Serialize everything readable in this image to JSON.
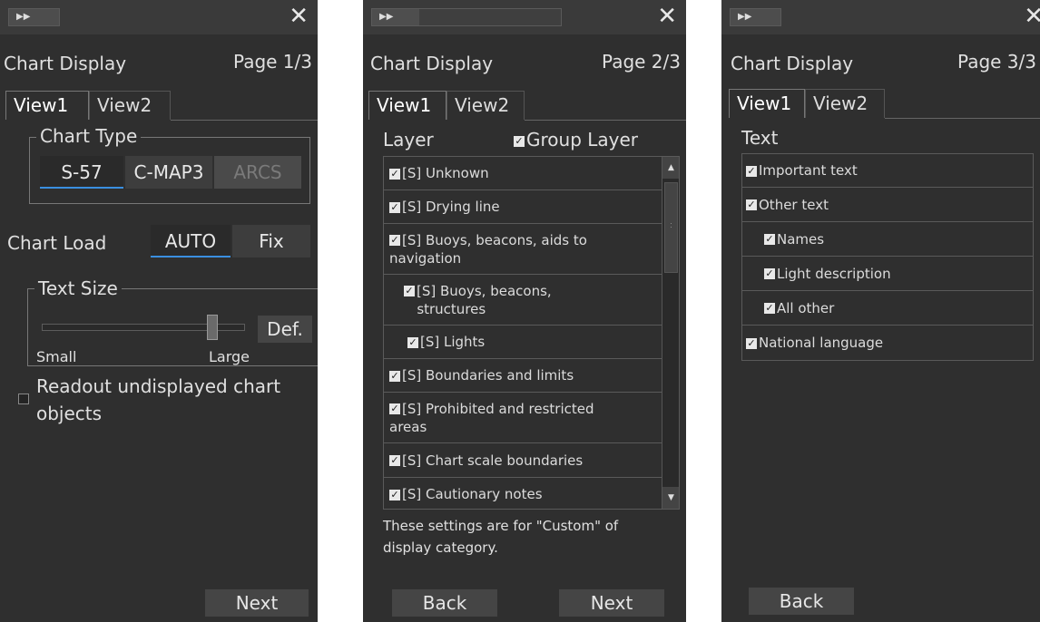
{
  "panels": [
    {
      "title": "Chart Display",
      "page": "Page 1/3",
      "tabs": [
        "View1",
        "View2"
      ],
      "chart_type": {
        "label": "Chart Type",
        "options": [
          "S-57",
          "C-MAP3",
          "ARCS"
        ],
        "selected": "S-57",
        "disabled": "ARCS"
      },
      "chart_load": {
        "label": "Chart Load",
        "options": [
          "AUTO",
          "Fix"
        ],
        "selected": "AUTO"
      },
      "text_size": {
        "label": "Text Size",
        "min_label": "Small",
        "max_label": "Large",
        "default_button": "Def.",
        "level": 0.86
      },
      "readout_checkbox": {
        "label_line1": "Readout undisplayed chart",
        "label_line2": "objects",
        "checked": false
      },
      "next_button": "Next"
    },
    {
      "title": "Chart Display",
      "page": "Page 2/3",
      "tabs": [
        "View1",
        "View2"
      ],
      "layer_label": "Layer",
      "group_layer": {
        "label": "Group Layer",
        "checked": true
      },
      "layers": [
        {
          "line1": "[S] Unknown",
          "checked": true
        },
        {
          "line1": "[S] Drying line",
          "checked": true
        },
        {
          "line1": "[S] Buoys, beacons, aids to",
          "line2": "navigation",
          "checked": true
        },
        {
          "line1": "[S] Buoys, beacons,",
          "line2": "structures",
          "checked": true
        },
        {
          "line1": "[S] Lights",
          "checked": true
        },
        {
          "line1": "[S] Boundaries and limits",
          "checked": true
        },
        {
          "line1": "[S] Prohibited and restricted",
          "line2": "areas",
          "checked": true
        },
        {
          "line1": "[S] Chart scale boundaries",
          "checked": true
        },
        {
          "line1": "[S] Cautionary notes",
          "checked": true
        }
      ],
      "note_line1": "These settings are for \"Custom\" of",
      "note_line2": "display category.",
      "back_button": "Back",
      "next_button": "Next"
    },
    {
      "title": "Chart Display",
      "page": "Page 3/3",
      "tabs": [
        "View1",
        "View2"
      ],
      "text_label": "Text",
      "items": [
        {
          "label": "Important text",
          "checked": true
        },
        {
          "label": "Other text",
          "checked": true
        },
        {
          "label": "Names",
          "checked": true
        },
        {
          "label": "Light description",
          "checked": true
        },
        {
          "label": "All other",
          "checked": true
        },
        {
          "label": "National language",
          "checked": true
        }
      ],
      "back_button": "Back"
    }
  ]
}
